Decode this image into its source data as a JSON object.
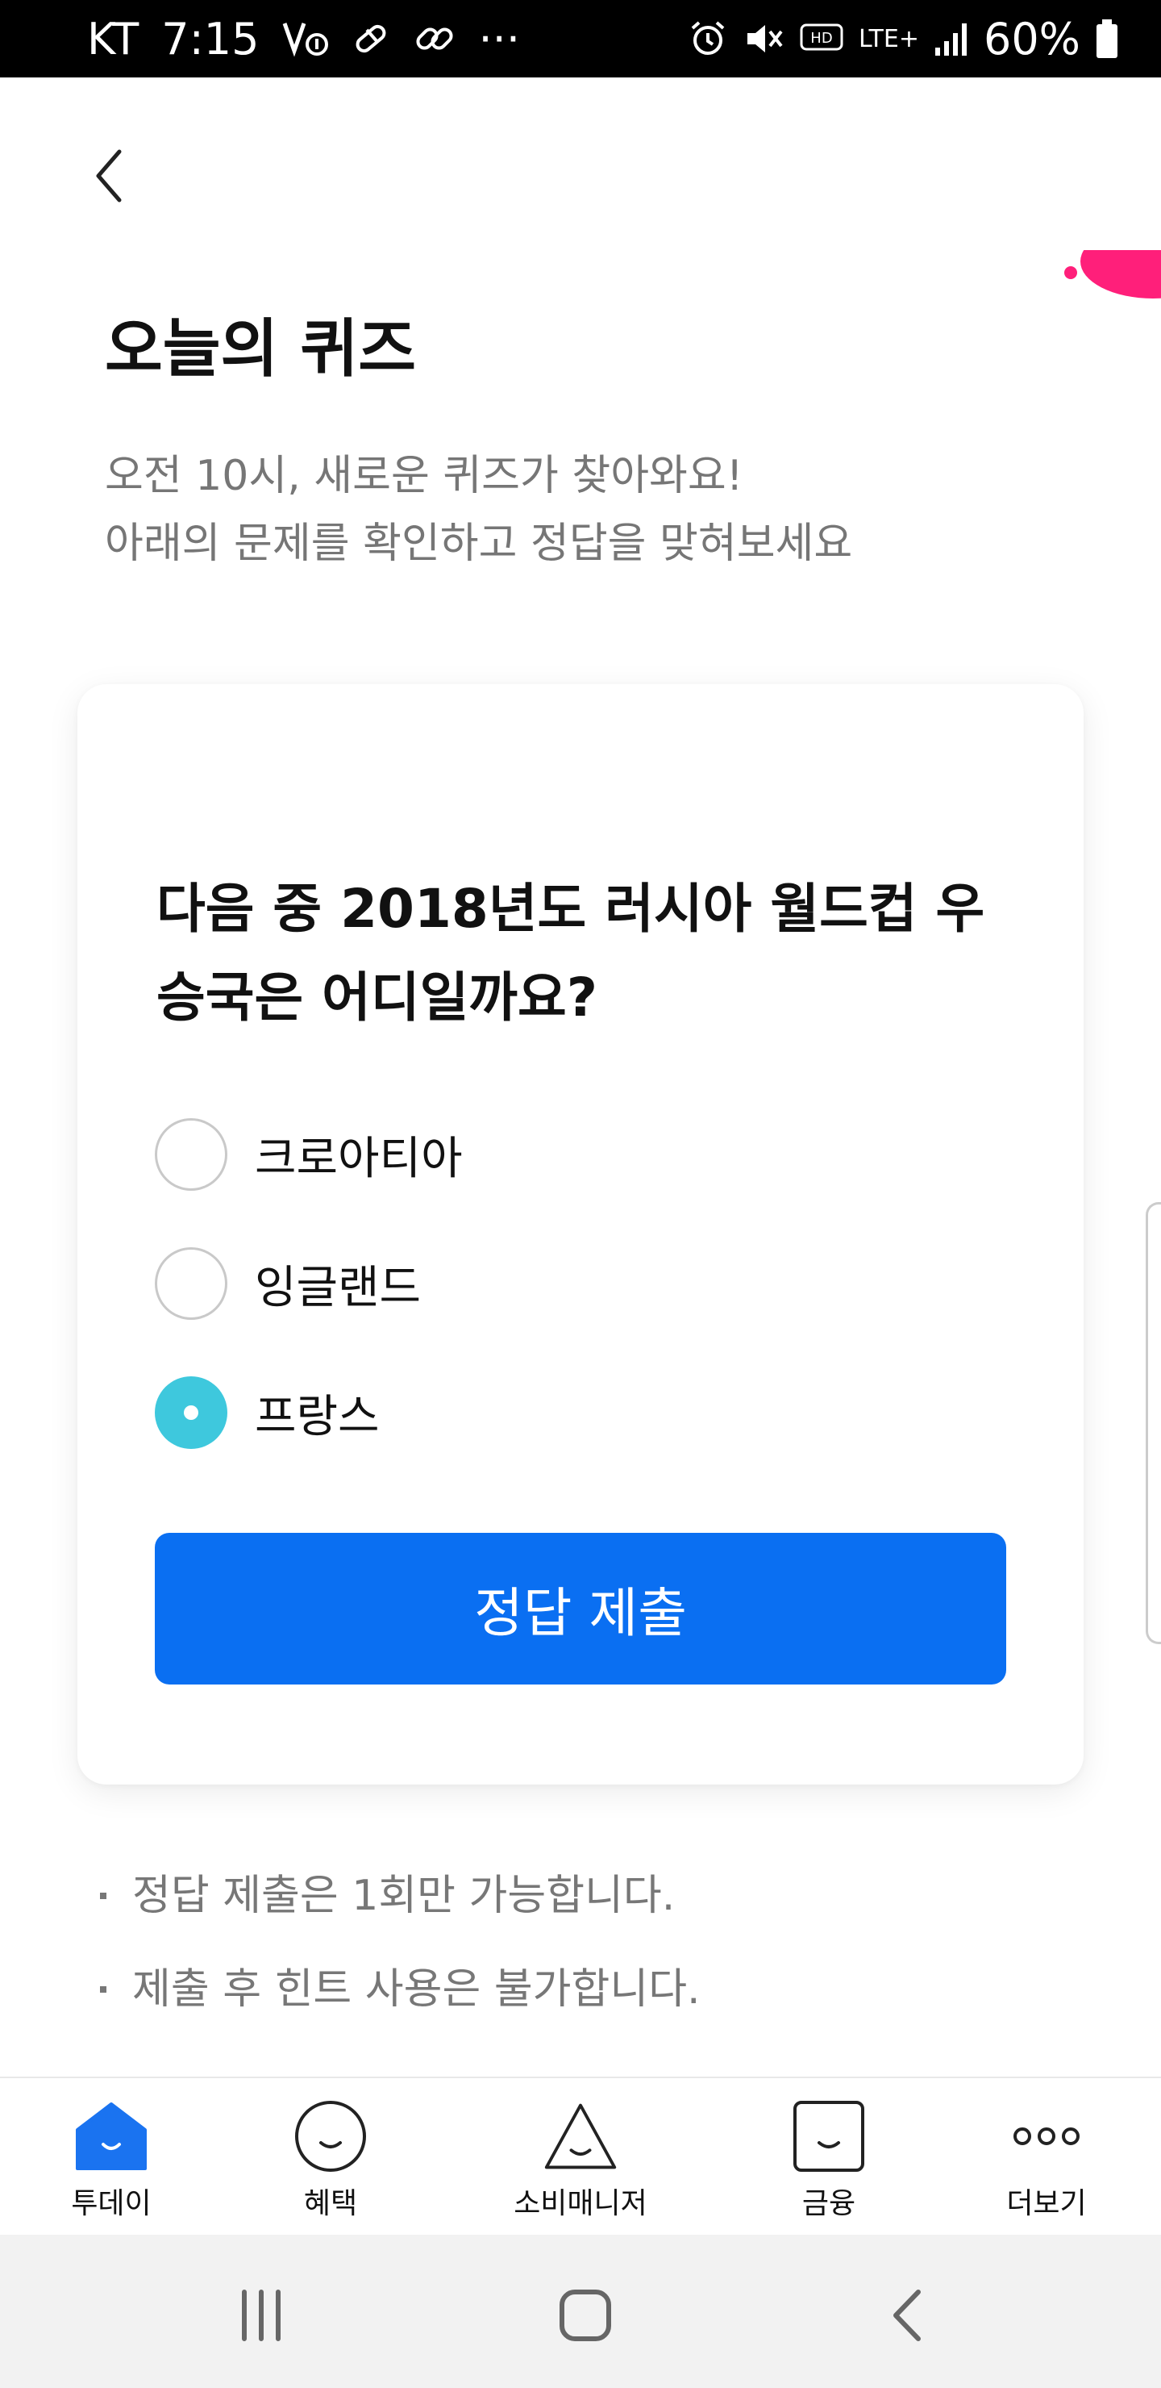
{
  "status_bar": {
    "carrier": "KT",
    "time": "7:15",
    "more": "···",
    "network": "LTE+",
    "battery": "60%"
  },
  "header": {
    "title": "오늘의 퀴즈",
    "subtitle_line1": "오전 10시, 새로운 퀴즈가 찾아와요!",
    "subtitle_line2": "아래의 문제를 확인하고 정답을 맞혀보세요"
  },
  "quiz": {
    "question_line1": "다음 중 2018년도 러시아 월드컵 우",
    "question_line2": "승국은 어디일까요?",
    "options": [
      {
        "label": "크로아티아",
        "selected": false
      },
      {
        "label": "잉글랜드",
        "selected": false
      },
      {
        "label": "프랑스",
        "selected": true
      }
    ],
    "submit_label": "정답 제출"
  },
  "notes": [
    "정답 제출은 1회만 가능합니다.",
    "제출 후 힌트 사용은 불가합니다."
  ],
  "bottom_nav": [
    {
      "label": "투데이",
      "icon": "home-icon",
      "active": true
    },
    {
      "label": "혜택",
      "icon": "smile-circle-icon",
      "active": false
    },
    {
      "label": "소비매니저",
      "icon": "smile-triangle-icon",
      "active": false
    },
    {
      "label": "금융",
      "icon": "smile-square-icon",
      "active": false
    },
    {
      "label": "더보기",
      "icon": "more-dots-icon",
      "active": false
    }
  ],
  "colors": {
    "accent_blue": "#0a6ff2",
    "radio_selected": "#3ec8dd",
    "nav_active": "#1a73f0",
    "decor_pink": "#ff1f7a"
  }
}
